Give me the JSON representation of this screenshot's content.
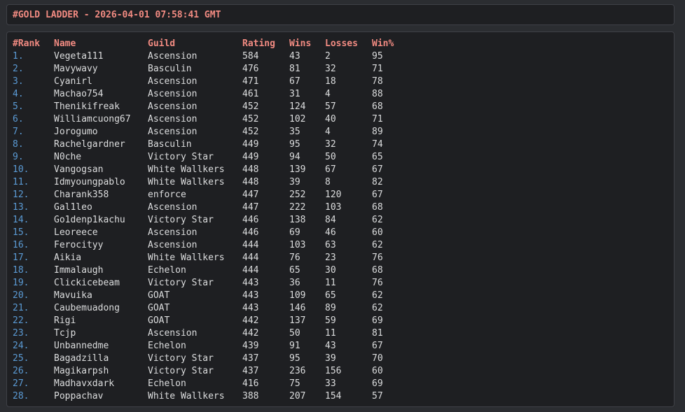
{
  "header": {
    "title": "#GOLD LADDER - 2026-04-01 07:58:41 GMT"
  },
  "table": {
    "columns": [
      "#Rank",
      "Name",
      "Guild",
      "Rating",
      "Wins",
      "Losses",
      "Win%"
    ],
    "rows": [
      [
        "1.",
        "Vegeta111",
        "Ascension",
        "584",
        "43",
        "2",
        "95"
      ],
      [
        "2.",
        "Mavywavy",
        "Basculin",
        "476",
        "81",
        "32",
        "71"
      ],
      [
        "3.",
        "Cyanirl",
        "Ascension",
        "471",
        "67",
        "18",
        "78"
      ],
      [
        "4.",
        "Machao754",
        "Ascension",
        "461",
        "31",
        "4",
        "88"
      ],
      [
        "5.",
        "Thenikifreak",
        "Ascension",
        "452",
        "124",
        "57",
        "68"
      ],
      [
        "6.",
        "Williamcuong67",
        "Ascension",
        "452",
        "102",
        "40",
        "71"
      ],
      [
        "7.",
        "Jorogumo",
        "Ascension",
        "452",
        "35",
        "4",
        "89"
      ],
      [
        "8.",
        "Rachelgardner",
        "Basculin",
        "449",
        "95",
        "32",
        "74"
      ],
      [
        "9.",
        "N0che",
        "Victory Star",
        "449",
        "94",
        "50",
        "65"
      ],
      [
        "10.",
        "Vangogsan",
        "White Wallkers",
        "448",
        "139",
        "67",
        "67"
      ],
      [
        "11.",
        "Idmyoungpablo",
        "White Wallkers",
        "448",
        "39",
        "8",
        "82"
      ],
      [
        "12.",
        "Charank358",
        "enforce",
        "447",
        "252",
        "120",
        "67"
      ],
      [
        "13.",
        "Gal1leo",
        "Ascension",
        "447",
        "222",
        "103",
        "68"
      ],
      [
        "14.",
        "Go1denp1kachu",
        "Victory Star",
        "446",
        "138",
        "84",
        "62"
      ],
      [
        "15.",
        "Leoreece",
        "Ascension",
        "446",
        "69",
        "46",
        "60"
      ],
      [
        "16.",
        "Ferocityy",
        "Ascension",
        "444",
        "103",
        "63",
        "62"
      ],
      [
        "17.",
        "Aikia",
        "White Wallkers",
        "444",
        "76",
        "23",
        "76"
      ],
      [
        "18.",
        "Immalaugh",
        "Echelon",
        "444",
        "65",
        "30",
        "68"
      ],
      [
        "19.",
        "Clickicebeam",
        "Victory Star",
        "443",
        "36",
        "11",
        "76"
      ],
      [
        "20.",
        "Mavuika",
        "GOAT",
        "443",
        "109",
        "65",
        "62"
      ],
      [
        "21.",
        "Caubemuadong",
        "GOAT",
        "443",
        "146",
        "89",
        "62"
      ],
      [
        "22.",
        "Rigi",
        "GOAT",
        "442",
        "137",
        "59",
        "69"
      ],
      [
        "23.",
        "Tcjp",
        "Ascension",
        "442",
        "50",
        "11",
        "81"
      ],
      [
        "24.",
        "Unbannedme",
        "Echelon",
        "439",
        "91",
        "43",
        "67"
      ],
      [
        "25.",
        "Bagadzilla",
        "Victory Star",
        "437",
        "95",
        "39",
        "70"
      ],
      [
        "26.",
        "Magikarpsh",
        "Victory Star",
        "437",
        "236",
        "156",
        "60"
      ],
      [
        "27.",
        "Madhavxdark",
        "Echelon",
        "416",
        "75",
        "33",
        "69"
      ],
      [
        "28.",
        "Poppachav",
        "White Wallkers",
        "388",
        "207",
        "154",
        "57"
      ]
    ]
  },
  "colors": {
    "background": "#2b2d31",
    "box": "#1e1f22",
    "header_text": "#f28b82",
    "rank_text": "#5b9bd5",
    "body_text": "#dcddde"
  }
}
